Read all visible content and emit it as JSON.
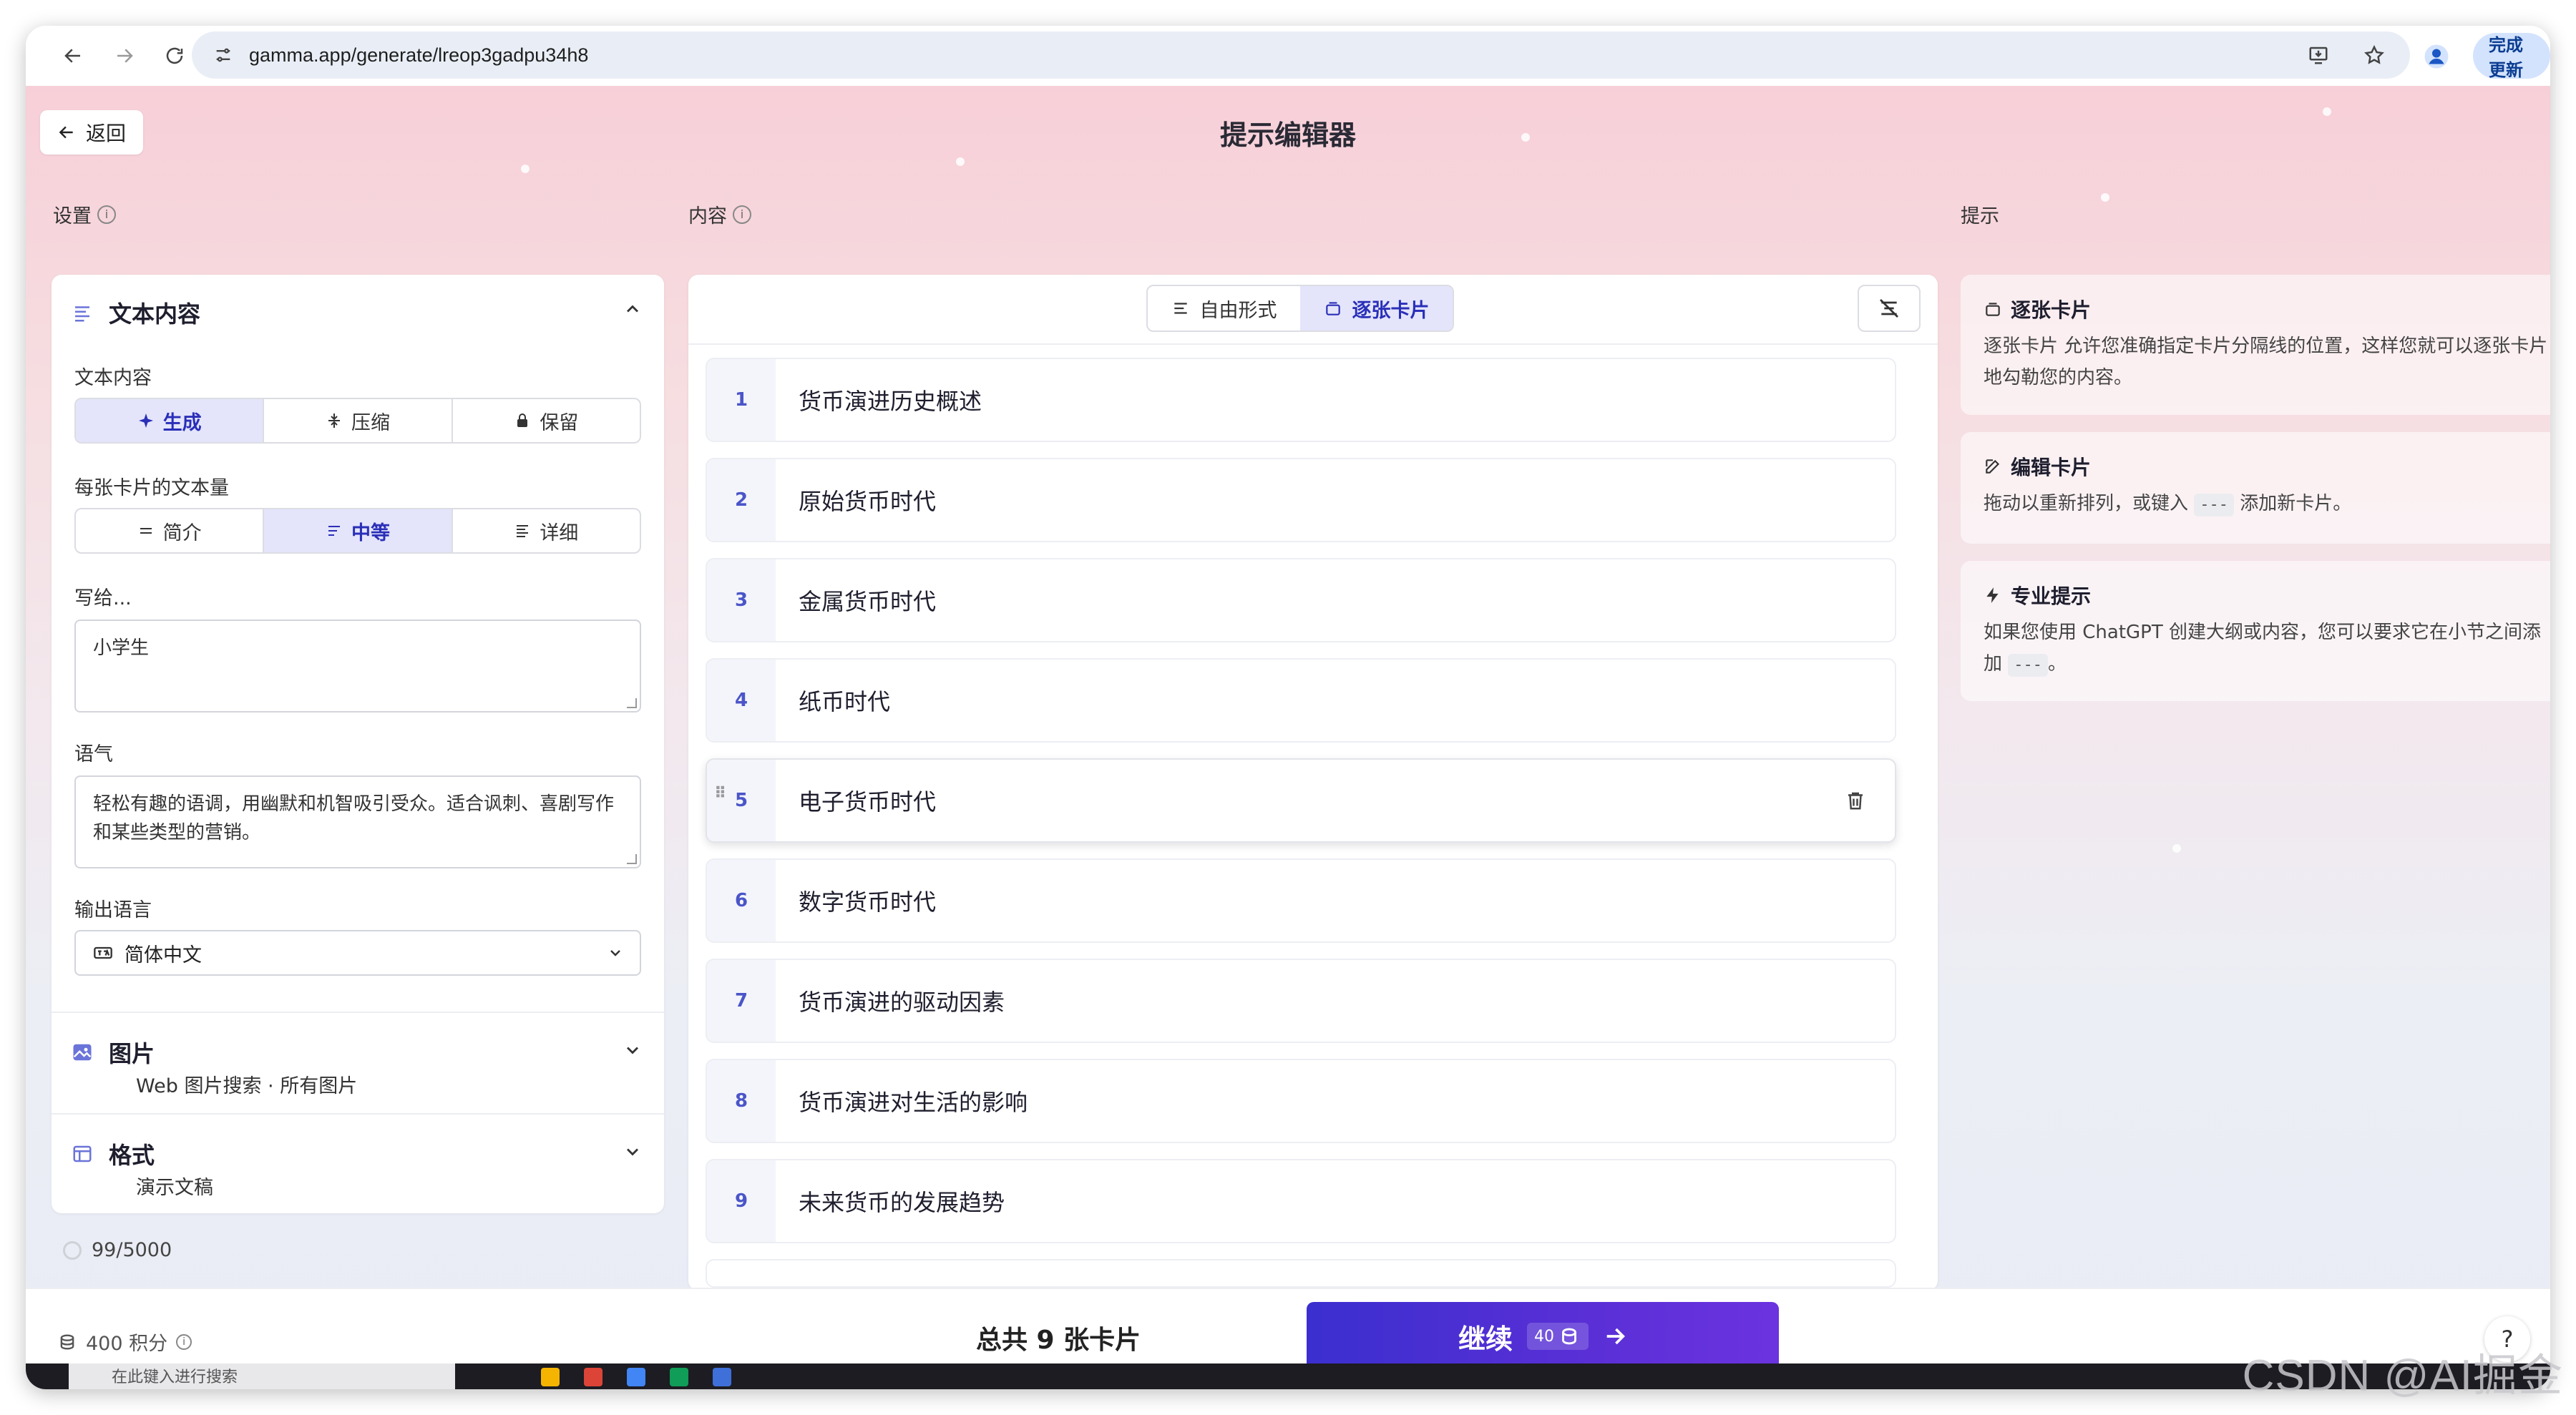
{
  "browser": {
    "url": "gamma.app/generate/lreop3gadpu34h8",
    "update_label": "完成更新"
  },
  "header": {
    "back_label": "返回",
    "title": "提示编辑器"
  },
  "settings": {
    "section_label": "设置",
    "text_content": {
      "title": "文本内容",
      "mode_label": "文本内容",
      "modes": [
        "生成",
        "压缩",
        "保留"
      ],
      "amount_label": "每张卡片的文本量",
      "amounts": [
        "简介",
        "中等",
        "详细"
      ],
      "audience_label": "写给...",
      "audience_value": "小学生",
      "tone_label": "语气",
      "tone_value": "轻松有趣的语调，用幽默和机智吸引受众。适合讽刺、喜剧写作和某些类型的营销。",
      "language_label": "输出语言",
      "language_value": "简体中文"
    },
    "images": {
      "title": "图片",
      "subtitle": "Web 图片搜索 · 所有图片"
    },
    "format": {
      "title": "格式",
      "subtitle": "演示文稿"
    },
    "usage": "99/5000"
  },
  "content": {
    "section_label": "内容",
    "modes": [
      "自由形式",
      "逐张卡片"
    ],
    "cards": [
      {
        "num": "1",
        "title": "货币演进历史概述"
      },
      {
        "num": "2",
        "title": "原始货币时代"
      },
      {
        "num": "3",
        "title": "金属货币时代"
      },
      {
        "num": "4",
        "title": "纸币时代"
      },
      {
        "num": "5",
        "title": "电子货币时代"
      },
      {
        "num": "6",
        "title": "数字货币时代"
      },
      {
        "num": "7",
        "title": "货币演进的驱动因素"
      },
      {
        "num": "8",
        "title": "货币演进对生活的影响"
      },
      {
        "num": "9",
        "title": "未来货币的发展趋势"
      }
    ]
  },
  "tips": {
    "section_label": "提示",
    "items": [
      {
        "title": "逐张卡片",
        "body": "逐张卡片 允许您准确指定卡片分隔线的位置，这样您就可以逐张卡片地勾勒您的内容。"
      },
      {
        "title": "编辑卡片",
        "body_before": "拖动以重新排列，或键入",
        "code": "---",
        "body_after": "添加新卡片。"
      },
      {
        "title": "专业提示",
        "body_before": "如果您使用 ChatGPT 创建大纲或内容，您可以要求它在小节之间添加",
        "code": "---",
        "body_after": "。"
      }
    ]
  },
  "footer": {
    "credits": "400 积分",
    "total": "总共 9 张卡片",
    "continue_label": "继续",
    "continue_cost": "40",
    "help": "?"
  },
  "taskbar": {
    "search_placeholder": "在此键入进行搜索"
  },
  "watermark": "CSDN @AI掘金",
  "colors": {
    "accent": "#3b2fcf",
    "active_bg": "#e4e5fb",
    "active_text": "#2a2fb8",
    "card_num": "#4b55c8"
  }
}
